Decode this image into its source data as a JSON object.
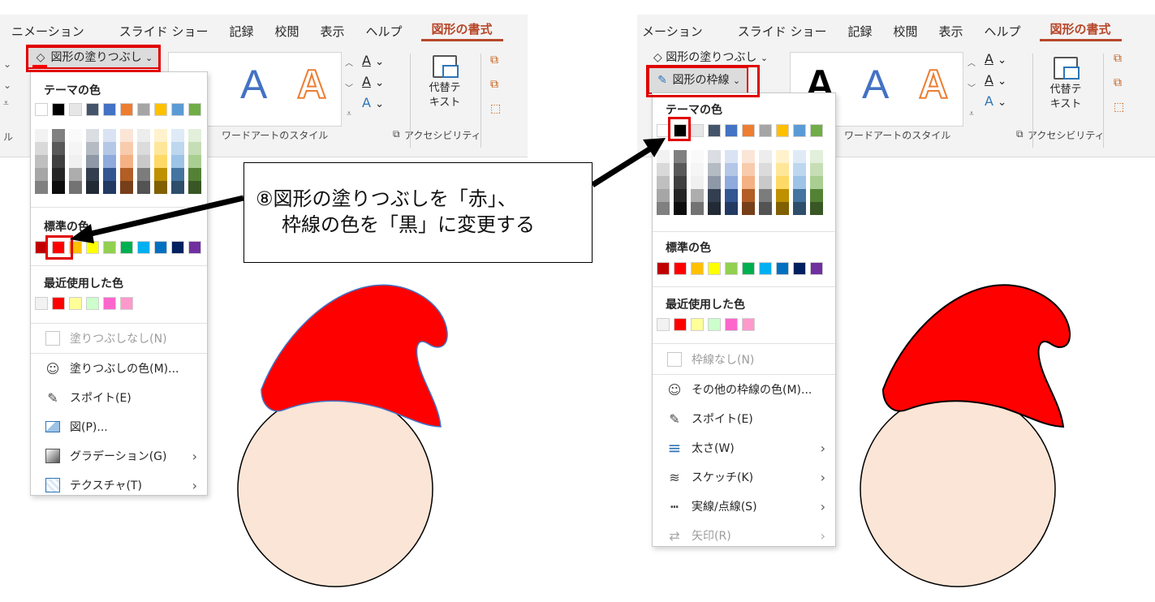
{
  "left_panel": {
    "tabs": [
      "ニメーション",
      "スライド ショー",
      "記録",
      "校閲",
      "表示",
      "ヘルプ",
      "図形の書式"
    ],
    "active_tab": "図形の書式",
    "fill_button_label": "図形の塗りつぶし",
    "group_label_wordart": "ワードアートのスタイル",
    "group_label_accessibility": "アクセシビリティ",
    "alt_text_label": "代替テ\nキスト",
    "menu": {
      "theme_heading": "テーマの色",
      "standard_heading": "標準の色",
      "recent_heading": "最近使用した色",
      "no_fill": "塗りつぶしなし(N)",
      "fill_color": "塗りつぶしの色(M)...",
      "eyedropper": "スポイト(E)",
      "picture": "図(P)...",
      "gradient": "グラデーション(G)",
      "texture": "テクスチャ(T)"
    }
  },
  "right_panel": {
    "tabs": [
      "メーション",
      "スライド ショー",
      "記録",
      "校閲",
      "表示",
      "ヘルプ",
      "図形の書式"
    ],
    "active_tab": "図形の書式",
    "fill_button_label": "図形の塗りつぶし",
    "outline_button_label": "図形の枠線",
    "group_label_wordart": "ワードアートのスタイル",
    "group_label_accessibility": "アクセシビリティ",
    "alt_text_label": "代替テ\nキスト",
    "menu": {
      "theme_heading": "テーマの色",
      "standard_heading": "標準の色",
      "recent_heading": "最近使用した色",
      "no_outline": "枠線なし(N)",
      "more_colors": "その他の枠線の色(M)...",
      "eyedropper": "スポイト(E)",
      "weight": "太さ(W)",
      "sketch": "スケッチ(K)",
      "dashes": "実線/点線(S)",
      "arrows": "矢印(R)"
    }
  },
  "callout": {
    "line1": "⑧図形の塗りつぶしを「赤」、",
    "line2": "枠線の色を「黒」に変更する"
  },
  "colors": {
    "theme": [
      "#ffffff",
      "#000000",
      "#e7e6e6",
      "#44546a",
      "#4472c4",
      "#ed7d31",
      "#a5a5a5",
      "#ffc000",
      "#5b9bd5",
      "#70ad47"
    ],
    "standard": [
      "#c00000",
      "#ff0000",
      "#ffc000",
      "#ffff00",
      "#92d050",
      "#00b050",
      "#00b0f0",
      "#0070c0",
      "#002060",
      "#7030a0"
    ],
    "recent": [
      "#f2f2f2",
      "#ff0000",
      "#ffff99",
      "#ccffcc",
      "#ff66cc",
      "#ff99cc"
    ],
    "hat_red": "#ff0000",
    "face": "#fbe5d6",
    "accent": "#b7472a",
    "highlight": "#e00000"
  },
  "icons": [
    "paint-bucket-icon",
    "pen-outline-icon",
    "palette-icon",
    "eyedropper-icon",
    "picture-icon",
    "gradient-icon",
    "texture-icon",
    "line-weight-icon",
    "sketch-icon",
    "dash-icon",
    "arrow-icon",
    "chevron-right-icon",
    "alt-text-icon"
  ]
}
